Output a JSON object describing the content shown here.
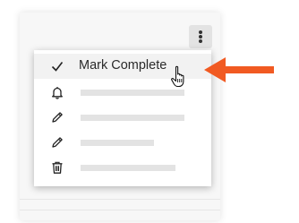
{
  "menu": {
    "items": [
      {
        "icon": "check-icon",
        "label": "Mark Complete",
        "placeholder": false
      },
      {
        "icon": "bell-icon",
        "label": "",
        "placeholder": true
      },
      {
        "icon": "pencil-icon",
        "label": "",
        "placeholder": true
      },
      {
        "icon": "pencil-icon",
        "label": "",
        "placeholder": true
      },
      {
        "icon": "trash-icon",
        "label": "",
        "placeholder": true
      }
    ]
  },
  "annotation": {
    "arrow_color": "#f15a22",
    "pointer": "hand-pointer-icon"
  },
  "colors": {
    "menu_bg": "#ffffff",
    "hover_bg": "#f2f2f2",
    "placeholder": "#e3e3e3"
  }
}
